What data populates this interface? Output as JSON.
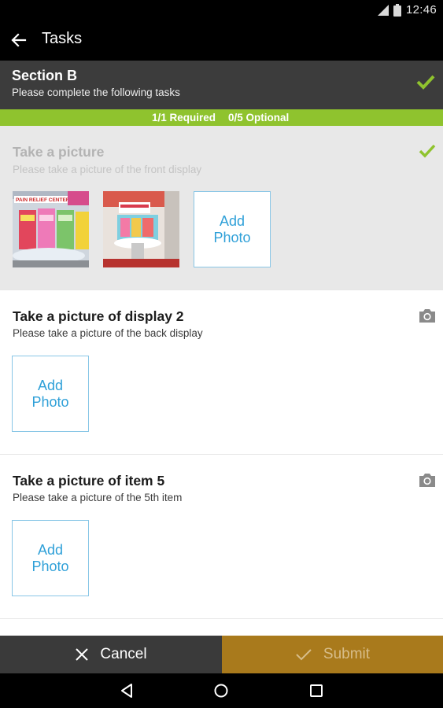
{
  "status_bar": {
    "time": "12:46",
    "icons": [
      "signal-icon",
      "battery-icon"
    ]
  },
  "app_bar": {
    "title": "Tasks",
    "back_icon": "arrow-back-icon"
  },
  "section": {
    "name": "Section B",
    "subtitle": "Please complete the following tasks",
    "complete_icon": "checkmark-icon"
  },
  "progress": {
    "required": "1/1 Required",
    "optional": "0/5 Optional"
  },
  "tasks": [
    {
      "title": "Take a picture",
      "description": "Please take a picture of the front display",
      "state": "completed",
      "status_icon": "checkmark-icon",
      "photos": [
        "store-display-photo-1",
        "store-display-photo-2"
      ],
      "add_photo_label": [
        "Add",
        "Photo"
      ]
    },
    {
      "title": "Take a picture of display 2",
      "description": "Please take a picture of the back display",
      "state": "pending",
      "status_icon": "camera-icon",
      "photos": [],
      "add_photo_label": [
        "Add",
        "Photo"
      ]
    },
    {
      "title": "Take a picture of item 5",
      "description": "Please take a picture of the 5th item",
      "state": "pending",
      "status_icon": "camera-icon",
      "photos": [],
      "add_photo_label": [
        "Add",
        "Photo"
      ]
    }
  ],
  "actions": {
    "cancel_label": "Cancel",
    "cancel_icon": "close-icon",
    "submit_label": "Submit",
    "submit_icon": "checkmark-icon"
  },
  "nav_bar": {
    "icons": [
      "nav-back-icon",
      "nav-home-icon",
      "nav-recents-icon"
    ]
  },
  "colors": {
    "accent_green": "#8fc32e",
    "section_bg": "#3c3c3c",
    "submit_bg": "#a97a1c",
    "add_photo_text": "#2fa0d8"
  }
}
